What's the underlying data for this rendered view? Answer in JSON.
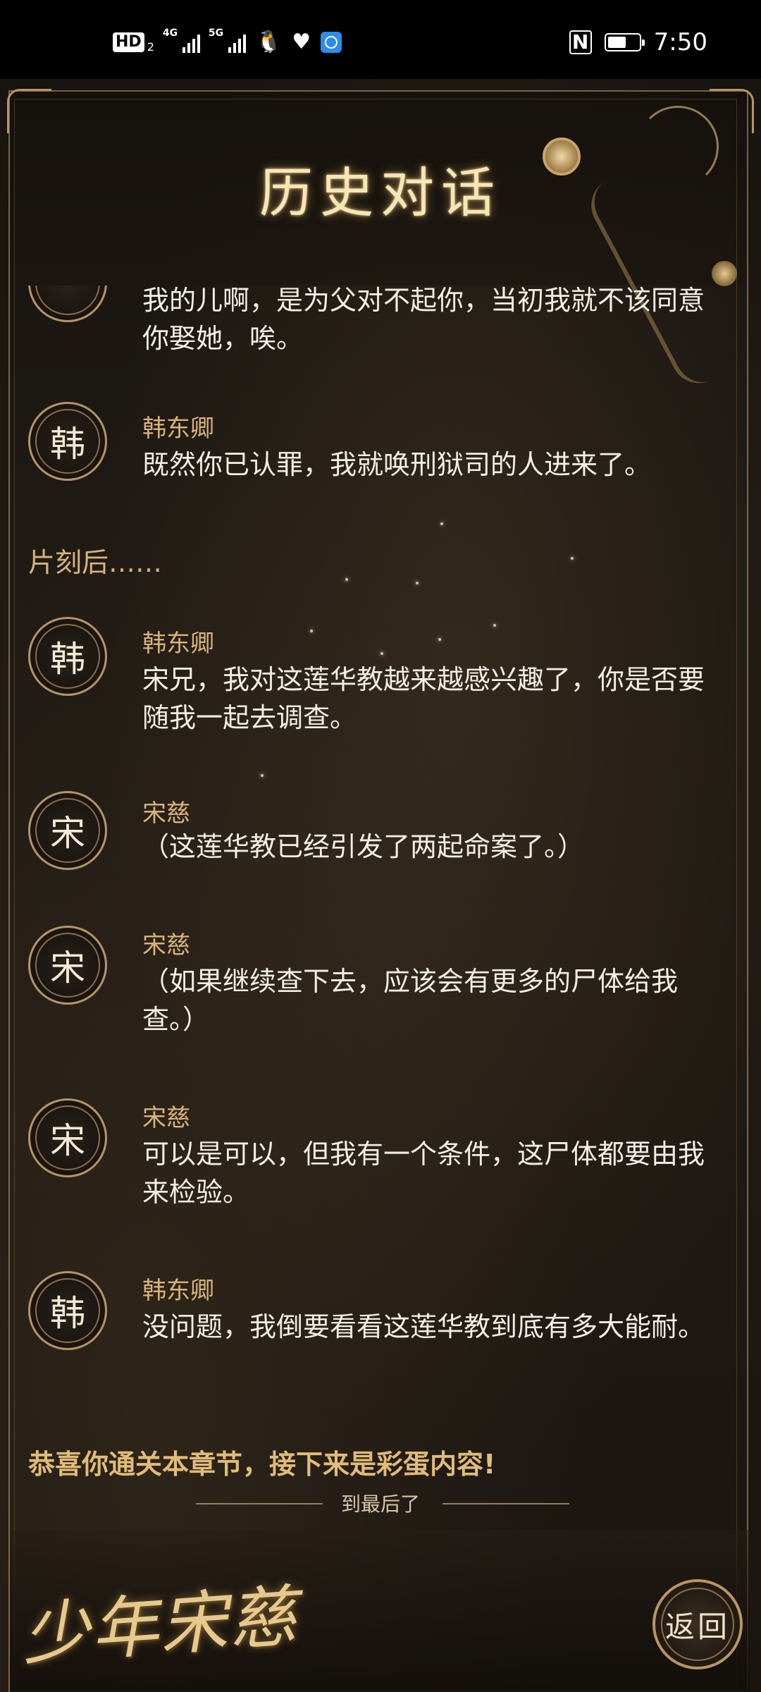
{
  "status_bar": {
    "hd_label": "HD",
    "sim_number": "2",
    "signal1_label": "4G",
    "signal2_label": "5G",
    "time": "7:50",
    "nfc_label": "N",
    "battery_level": 0.6,
    "icons": [
      "qq-icon",
      "heart-pulse-icon",
      "browser-icon"
    ]
  },
  "page": {
    "title": "历史对话"
  },
  "dialog": {
    "partial_top": "我的儿啊，是为父对不起你，当初我就不该同意你娶她，唉。",
    "entries": [
      {
        "avatar": "韩",
        "speaker": "韩东卿",
        "text": "既然你已认罪，我就唤刑狱司的人进来了。"
      },
      {
        "narration": "片刻后……"
      },
      {
        "avatar": "韩",
        "speaker": "韩东卿",
        "text": "宋兄，我对这莲华教越来越感兴趣了，你是否要随我一起去调查。"
      },
      {
        "avatar": "宋",
        "speaker": "宋慈",
        "text": "（这莲华教已经引发了两起命案了。）"
      },
      {
        "avatar": "宋",
        "speaker": "宋慈",
        "text": "（如果继续查下去，应该会有更多的尸体给我查。）"
      },
      {
        "avatar": "宋",
        "speaker": "宋慈",
        "text": "可以是可以，但我有一个条件，这尸体都要由我来检验。"
      },
      {
        "avatar": "韩",
        "speaker": "韩东卿",
        "text": "没问题，我倒要看看这莲华教到底有多大能耐。"
      }
    ]
  },
  "footer": {
    "congrats": "恭喜你通关本章节，接下来是彩蛋内容!",
    "end_marker": "到最后了",
    "logo_text": "少年宋慈",
    "back_label": "返回"
  },
  "colors": {
    "accent_gold": "#d8b47a",
    "title_glow": "#f7e6b6",
    "text": "#f2efe8"
  }
}
